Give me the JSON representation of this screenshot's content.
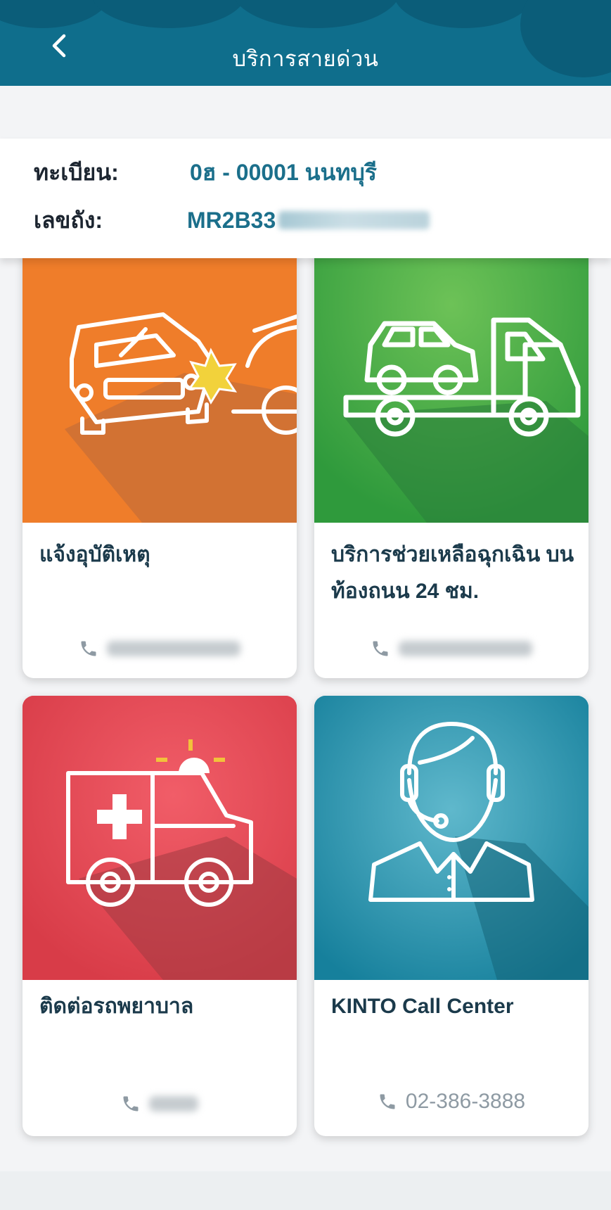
{
  "header": {
    "title": "บริการสายด่วน"
  },
  "vehicle": {
    "plate_label": "ทะเบียน:",
    "plate_value": "0ฮ - 00001 นนทบุรี",
    "vin_label": "เลขถัง:",
    "vin_value": "MR2B33"
  },
  "services": [
    {
      "title": "แจ้งอุบัติเหตุ",
      "icon": "car-accident-icon",
      "color": "#ef7d2a"
    },
    {
      "title": "บริการช่วยเหลือฉุกเฉิน บนท้องถนน 24 ชม.",
      "icon": "tow-truck-icon",
      "color": "#35a441"
    },
    {
      "title": "ติดต่อรถพยาบาล",
      "icon": "ambulance-icon",
      "color": "#e0434f"
    },
    {
      "title": "KINTO Call Center",
      "icon": "call-center-agent-icon",
      "color": "#1a8ea8",
      "phone": "02-386-3888"
    }
  ],
  "colors": {
    "header_bg": "#0f6e8c",
    "accent_text": "#1b6f8b"
  }
}
